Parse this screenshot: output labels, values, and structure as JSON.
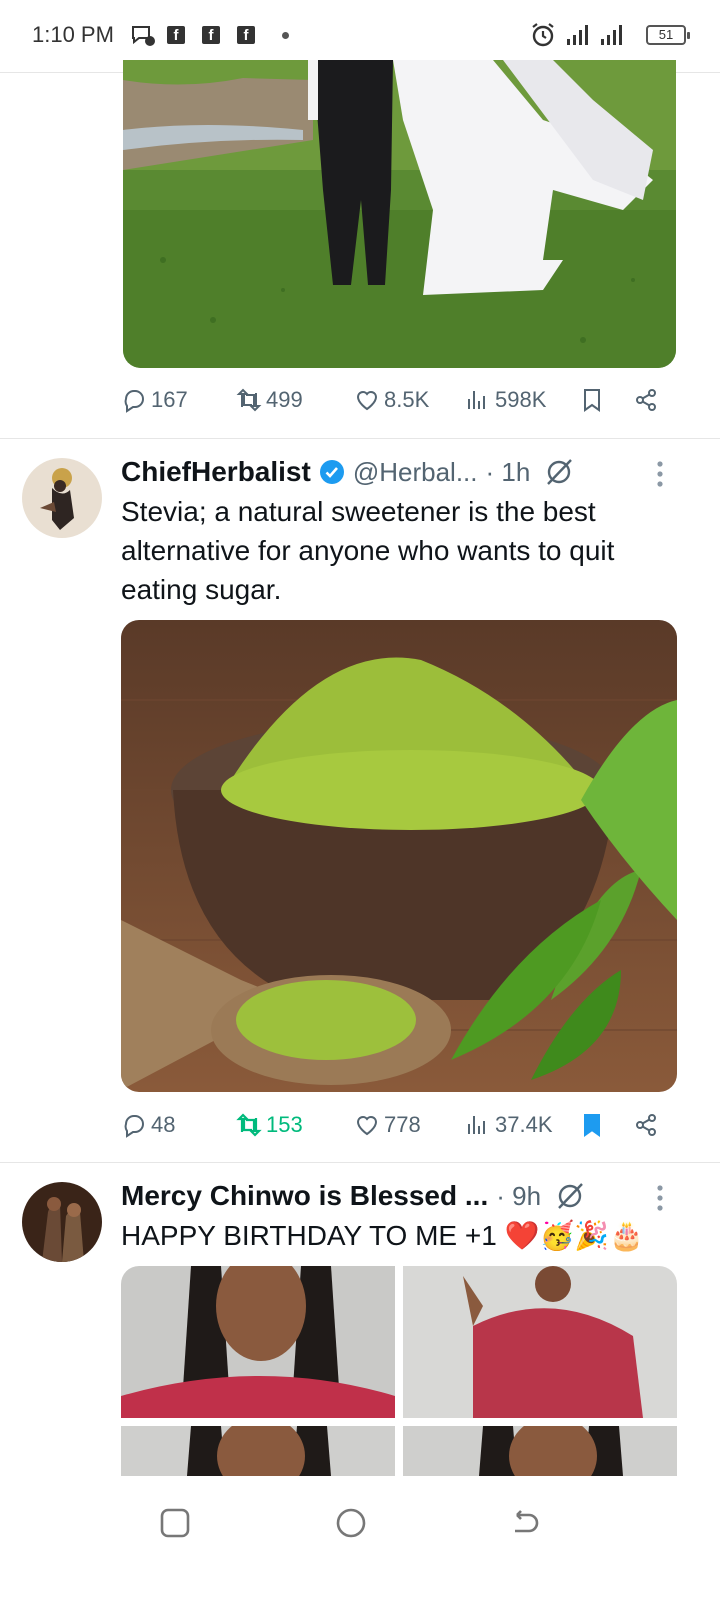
{
  "status_bar": {
    "time": "1:10 PM",
    "battery": "51",
    "icons": [
      "chat-icon",
      "facebook-icon",
      "facebook-icon",
      "facebook-icon",
      "alarm-icon",
      "signal-icon",
      "signal-icon",
      "battery-icon"
    ]
  },
  "colors": {
    "accent": "#1d9bf0",
    "retweet_active": "#00ba7c",
    "muted": "#536471"
  },
  "tweets": [
    {
      "actions": {
        "replies": "167",
        "retweets": "499",
        "likes": "8.5K",
        "views": "598K",
        "bookmarked": false,
        "retweeted": false
      }
    },
    {
      "name": "ChiefHerbalist",
      "verified": true,
      "handle": "@Herbal...",
      "time": "· 1h",
      "text": "Stevia; a natural sweetener is the best alternative for anyone who wants to quit eating sugar.",
      "actions": {
        "replies": "48",
        "retweets": "153",
        "likes": "778",
        "views": "37.4K",
        "bookmarked": true,
        "retweeted": true
      }
    },
    {
      "name": "Mercy Chinwo is Blessed ...",
      "handle": "",
      "time": "· 9h",
      "text": "HAPPY BIRTHDAY TO ME +1 ❤️🥳🎉🎂"
    }
  ]
}
